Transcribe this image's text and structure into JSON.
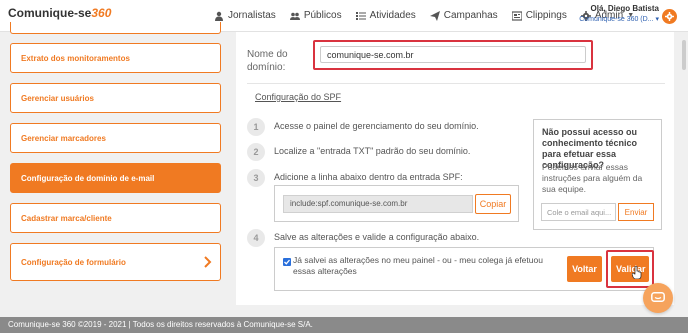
{
  "header": {
    "logo_main": "Comunique-se",
    "logo_accent": "360",
    "nav": [
      {
        "label": "Jornalistas",
        "icon": "users-icon"
      },
      {
        "label": "Públicos",
        "icon": "group-icon"
      },
      {
        "label": "Atividades",
        "icon": "list-icon"
      },
      {
        "label": "Campanhas",
        "icon": "send-icon"
      },
      {
        "label": "Clippings",
        "icon": "newspaper-icon"
      },
      {
        "label": "Admin",
        "icon": "gear-icon"
      }
    ],
    "user_greeting": "Olá, Diego Batista",
    "user_org": "Comunique-se 360 (D... ▾"
  },
  "sidebar": {
    "items": [
      {
        "label": "Extrato dos monitoramentos"
      },
      {
        "label": "Gerenciar usuários"
      },
      {
        "label": "Gerenciar marcadores"
      },
      {
        "label": "Configuração de domínio de e-mail"
      },
      {
        "label": "Cadastrar marca/cliente"
      },
      {
        "label": "Configuração de formulário"
      }
    ]
  },
  "main": {
    "domain_label": "Nome do domínio:",
    "domain_value": "comunique-se.com.br",
    "spf_link": "Configuração do SPF",
    "steps": [
      {
        "num": "1",
        "text": "Acesse o painel de gerenciamento do seu domínio."
      },
      {
        "num": "2",
        "text": "Localize a \"entrada TXT\" padrão do seu domínio."
      },
      {
        "num": "3",
        "text": "Adicione a linha abaixo dentro da entrada SPF:"
      },
      {
        "num": "4",
        "text": "Salve as alterações e valide a configuração abaixo."
      }
    ],
    "spf_value": "include:spf.comunique-se.com.br",
    "copy_label": "Copiar",
    "save_checkbox_text": "Já salvei as alterações no meu painel - ou - meu colega já efetuou essas alterações",
    "back_label": "Voltar",
    "validate_label": "Validar"
  },
  "help": {
    "title": "Não possui acesso ou conhecimento técnico para efetuar essa configuração?",
    "body": "Podemos enviar essas instruções para alguém da sua equipe.",
    "email_placeholder": "Cole o email aqui...",
    "send_label": "Enviar"
  },
  "footer": {
    "text": "Comunique-se 360 ©2019 - 2021 | Todos os direitos reservados à Comunique-se S/A."
  },
  "colors": {
    "accent": "#f07a22",
    "highlight": "#d9333f"
  }
}
